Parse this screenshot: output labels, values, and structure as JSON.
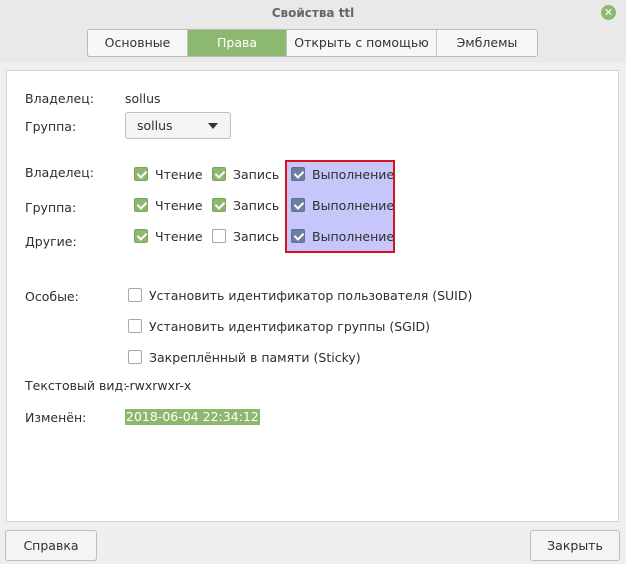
{
  "window": {
    "title": "Свойства ttl"
  },
  "tabs": [
    {
      "label": "Основные"
    },
    {
      "label": "Права"
    },
    {
      "label": "Открыть с помощью"
    },
    {
      "label": "Эмблемы"
    }
  ],
  "ownership": {
    "owner_label": "Владелец:",
    "owner_value": "sollus",
    "group_label": "Группа:",
    "group_value": "sollus"
  },
  "permissions": {
    "rows": [
      {
        "label": "Владелец:",
        "read": "Чтение",
        "write": "Запись",
        "exec": "Выполнение",
        "read_checked": true,
        "write_checked": true,
        "exec_checked": true
      },
      {
        "label": "Группа:",
        "read": "Чтение",
        "write": "Запись",
        "exec": "Выполнение",
        "read_checked": true,
        "write_checked": true,
        "exec_checked": true
      },
      {
        "label": "Другие:",
        "read": "Чтение",
        "write": "Запись",
        "exec": "Выполнение",
        "read_checked": true,
        "write_checked": false,
        "exec_checked": true
      }
    ]
  },
  "special": {
    "label": "Особые:",
    "options": [
      {
        "label": "Установить идентификатор пользователя (SUID)",
        "checked": false
      },
      {
        "label": "Установить идентификатор группы (SGID)",
        "checked": false
      },
      {
        "label": "Закреплённый в памяти (Sticky)",
        "checked": false
      }
    ]
  },
  "text_view": {
    "label": "Текстовый вид:",
    "value": "-rwxrwxr-x"
  },
  "modified": {
    "label": "Изменён:",
    "value": "2018-06-04 22:34:12"
  },
  "buttons": {
    "help": "Справка",
    "close": "Закрыть"
  },
  "colors": {
    "accent": "#8db870",
    "highlight_fill": "#c6c6fb",
    "highlight_border": "#d8121e"
  }
}
